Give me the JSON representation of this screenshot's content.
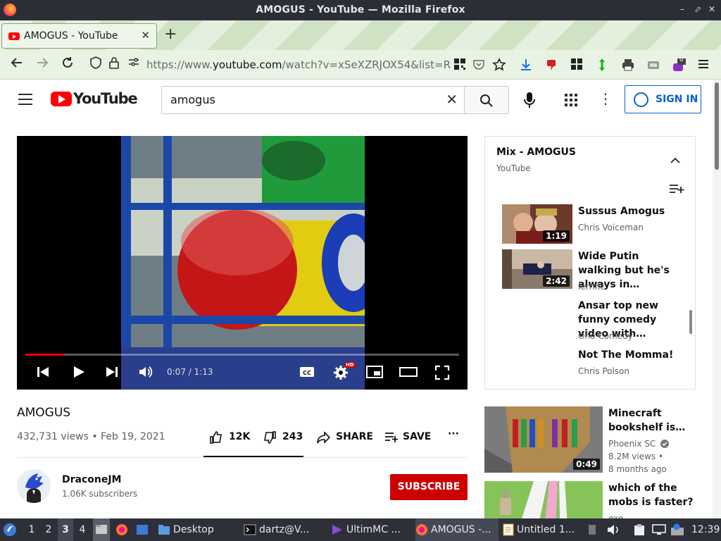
{
  "window": {
    "title": "AMOGUS - YouTube — Mozilla Firefox",
    "controls": [
      "–",
      "⬀",
      "✕"
    ]
  },
  "browser": {
    "tab": {
      "title": "AMOGUS - YouTube",
      "close": "✕"
    },
    "new_tab": "+",
    "url": {
      "prefix": "https://www.",
      "domain": "youtube.com",
      "path": "/watch?v=xSeXZRJOX54&list=RD5D"
    },
    "toolbar_badge": "0"
  },
  "youtube": {
    "logo_text": "YouTube",
    "search": {
      "query": "amogus",
      "clear": "✕"
    },
    "sign_in": "SIGN IN"
  },
  "video": {
    "progress": 0.09,
    "time": "0:07 / 1:13",
    "title": "AMOGUS",
    "meta": "432,731 views • Feb 19, 2021",
    "likes": "12K",
    "dislikes": "243",
    "share": "SHARE",
    "save": "SAVE",
    "more": "···",
    "hd_badge": "HD"
  },
  "channel": {
    "name": "DraconeJM",
    "subscribers": "1.06K subscribers",
    "subscribe": "SUBSCRIBE"
  },
  "mix": {
    "title": "Mix - AMOGUS",
    "subtitle": "YouTube",
    "items": [
      {
        "title": "Sussus Amogus",
        "channel": "Chris Voiceman",
        "duration": "1:19"
      },
      {
        "title": "Wide Putin walking but he's always in…",
        "channel": "lerrific",
        "duration": "2:42"
      },
      {
        "title": "Ansar top new funny comedy video with…",
        "channel": "Oho Comedy"
      },
      {
        "title": "Not The Momma!",
        "channel": "Chris Polson"
      }
    ]
  },
  "recommendations": [
    {
      "title": "Minecraft bookshelf is…",
      "channel": "Phoenix SC",
      "views": "8.2M views •",
      "age": "8 months ago",
      "duration": "0:49",
      "verified": true
    },
    {
      "title": "which of the mobs is faster?",
      "channel": "exe"
    }
  ],
  "taskbar": {
    "workspaces": [
      "1",
      "2",
      "3",
      "4"
    ],
    "active_workspace": "3",
    "windows": [
      {
        "label": "Desktop"
      },
      {
        "label": "dartz@V..."
      },
      {
        "label": "UltimMC ..."
      },
      {
        "label": "AMOGUS -..."
      },
      {
        "label": "Untitled 1..."
      }
    ],
    "clock": "12:39"
  }
}
